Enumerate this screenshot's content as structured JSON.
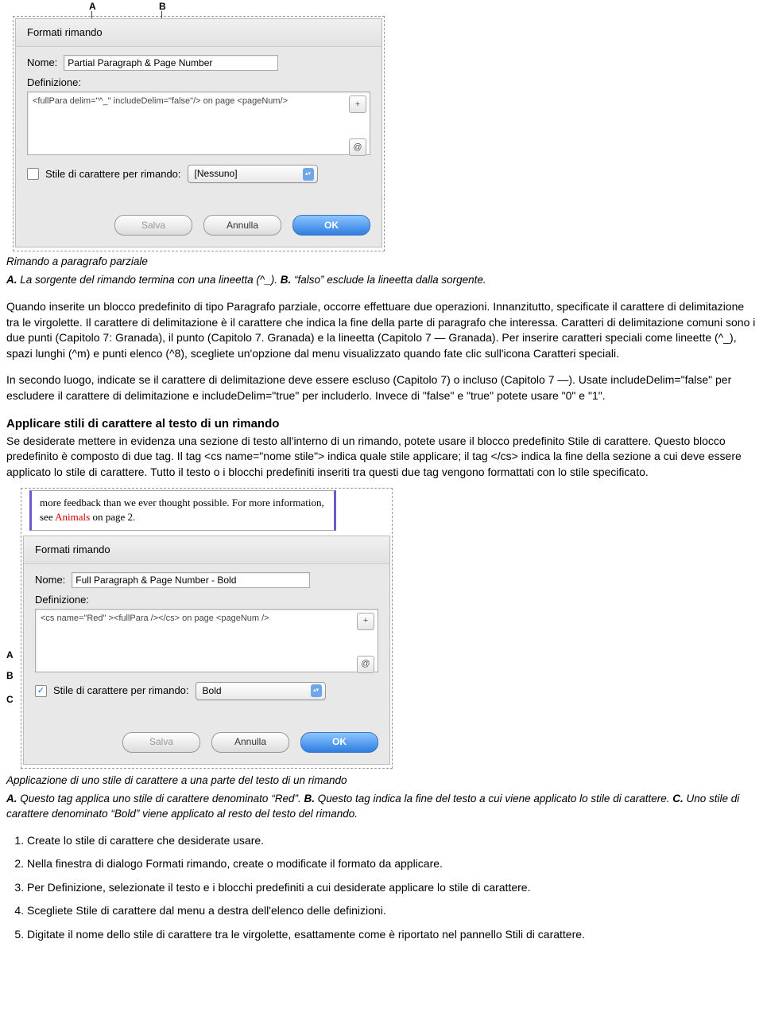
{
  "figure1": {
    "callout_A": "A",
    "callout_B": "B",
    "dialog_title": "Formati rimando",
    "nome_label": "Nome:",
    "nome_value": "Partial Paragraph & Page Number",
    "def_label": "Definizione:",
    "def_text": "<fullPara delim=\"^_\" includeDelim=\"false\"/> on page <pageNum/>",
    "style_checkbox_label": "Stile di carattere per rimando:",
    "style_value": "[Nessuno]",
    "btn_save": "Salva",
    "btn_cancel": "Annulla",
    "btn_ok": "OK",
    "caption": "Rimando a paragrafo parziale",
    "legend": "<b>A.</b>  La sorgente del rimando termina con una lineetta (^_).  <b>B.</b>  “falso” esclude la lineetta dalla sorgente."
  },
  "body": {
    "p1": "Quando inserite un blocco predefinito di tipo Paragrafo parziale, occorre effettuare due operazioni. Innanzitutto, specificate il carattere di delimitazione tra le virgolette. Il carattere di delimitazione è il carattere che indica la fine della parte di paragrafo che interessa. Caratteri di delimitazione comuni sono i due punti (Capitolo 7: Granada), il punto (Capitolo 7. Granada) e la lineetta (Capitolo 7 — Granada). Per inserire caratteri speciali come lineette (^_), spazi lunghi (^m) e punti elenco (^8), scegliete un'opzione dal menu visualizzato quando fate clic sull'icona Caratteri speciali.",
    "p2": "In secondo luogo, indicate se il carattere di delimitazione deve essere escluso (Capitolo 7) o incluso (Capitolo 7 —). Usate includeDelim=\"false\" per escludere il carattere di delimitazione e includeDelim=\"true\" per includerlo. Invece di \"false\" e \"true\" potete usare \"0\" e \"1\".",
    "h": "Applicare stili di carattere al testo di un rimando",
    "p3": "Se desiderate mettere in evidenza una sezione di testo all'interno di un rimando, potete usare il blocco predefinito Stile di carattere. Questo blocco predefinito è composto di due tag. Il tag <cs name=\"nome stile\"> indica quale stile applicare; il tag </cs> indica la fine della sezione a cui deve essere applicato lo stile di carattere. Tutto il testo o i blocchi predefiniti inseriti tra questi due tag vengono formattati con lo stile specificato."
  },
  "figure2": {
    "preview_line1": "more feedback than we ever thought possible. For more information, see",
    "preview_red": "Animals",
    "preview_after": " on page 2.",
    "dialog_title": "Formati rimando",
    "nome_label": "Nome:",
    "nome_value": "Full Paragraph & Page Number - Bold",
    "def_label": "Definizione:",
    "def_text": "<cs name=\"Red\" ><fullPara /></cs> on page <pageNum />",
    "style_checkbox_checked": true,
    "style_checkbox_label": "Stile di carattere per rimando:",
    "style_value": "Bold",
    "btn_save": "Salva",
    "btn_cancel": "Annulla",
    "btn_ok": "OK",
    "side_A": "A",
    "side_B": "B",
    "side_C": "C",
    "caption": "Applicazione di uno stile di carattere a una parte del testo di un rimando",
    "legend": "<b>A.</b>  Questo tag applica uno stile di carattere denominato “Red”.  <b>B.</b>  Questo tag indica la fine del testo a cui viene applicato lo stile di carattere.  <b>C.</b>  Uno stile di carattere denominato “Bold” viene applicato al resto del testo del rimando."
  },
  "steps": {
    "s1": "Create lo stile di carattere che desiderate usare.",
    "s2": "Nella finestra di dialogo Formati rimando, create o modificate il formato da applicare.",
    "s3": "Per Definizione, selezionate il testo e i blocchi predefiniti a cui desiderate applicare lo stile di carattere.",
    "s4": "Scegliete Stile di carattere dal menu a destra dell'elenco delle definizioni.",
    "s5": "Digitate il nome dello stile di carattere tra le virgolette, esattamente come è riportato nel pannello Stili di carattere."
  },
  "icons": {
    "plus": "+",
    "at": "@",
    "updown": "▴▾",
    "check": "✓"
  }
}
